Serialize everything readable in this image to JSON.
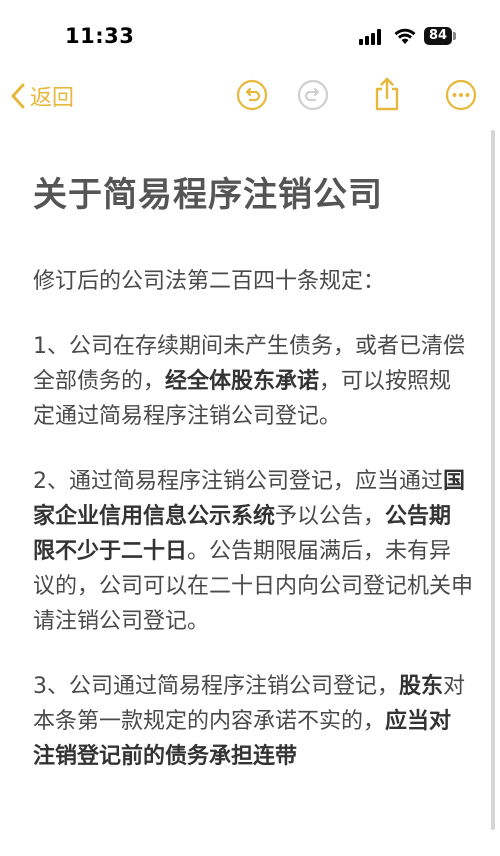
{
  "status_bar": {
    "time": "11:33",
    "battery": "84"
  },
  "nav": {
    "back_label": "返回",
    "accent_color": "#e6b83c"
  },
  "note": {
    "title": "关于简易程序注销公司",
    "intro": "修订后的公司法第二百四十条规定：",
    "p1": {
      "a": "1、公司在存续期间未产生债务，或者已清偿全部债务的，",
      "b": "经全体股东承诺",
      "c": "，可以按照规定通过简易程序注销公司登记。"
    },
    "p2": {
      "a": "2、通过简易程序注销公司登记，应当通过",
      "b": "国家企业信用信息公示系统",
      "c": "予以公告，",
      "d": "公告期限不少于二十日",
      "e": "。公告期限届满后，未有异议的，公司可以在二十日内向公司登记机关申请注销公司登记。"
    },
    "p3": {
      "a": "3、公司通过简易程序注销公司登记，",
      "b": "股东",
      "c": "对本条第一款规定的内容承诺不实的，",
      "d": "应当对注销登记前的债务承担连带"
    }
  }
}
